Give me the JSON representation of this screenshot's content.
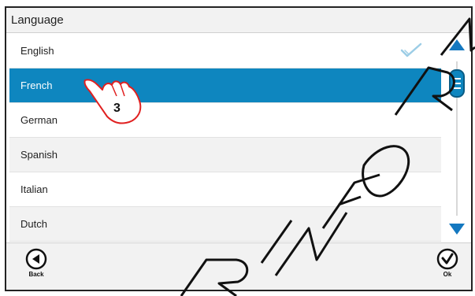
{
  "title": "Language",
  "languages": [
    {
      "label": "English"
    },
    {
      "label": "French"
    },
    {
      "label": "German"
    },
    {
      "label": "Spanish"
    },
    {
      "label": "Italian"
    },
    {
      "label": "Dutch"
    }
  ],
  "current_language": "English",
  "selected_language": "French",
  "step_number": "3",
  "buttons": {
    "back_label": "Back",
    "ok_label": "Ok"
  },
  "colors": {
    "selection": "#0e86bf",
    "scroll_arrows": "#1478c0",
    "checkmark": "#9ccde6",
    "hand": "#e02020"
  },
  "icons": {
    "check": "checkmark-icon",
    "back": "back-arrow-icon",
    "ok": "ok-check-icon",
    "pointer": "pointing-hand-icon"
  }
}
